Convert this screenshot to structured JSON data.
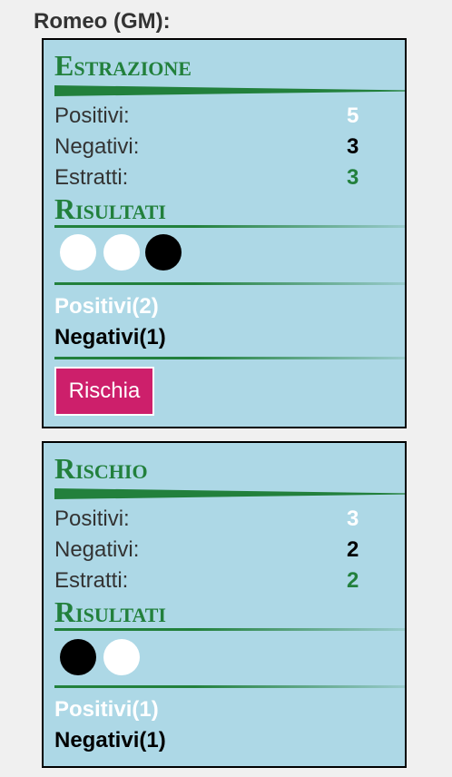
{
  "player_heading": "Romeo (GM):",
  "panels": [
    {
      "title": "Estrazione",
      "rows": [
        {
          "label": "Positivi:",
          "value": "5"
        },
        {
          "label": "Negativi:",
          "value": "3"
        },
        {
          "label": "Estratti:",
          "value": "3"
        }
      ],
      "results_title": "Risultati",
      "balls": [
        "white",
        "white",
        "black"
      ],
      "positivi_summary": "Positivi(2)",
      "negativi_summary": "Negativi(1)",
      "button_label": "Rischia"
    },
    {
      "title": "Rischio",
      "rows": [
        {
          "label": "Positivi:",
          "value": "3"
        },
        {
          "label": "Negativi:",
          "value": "2"
        },
        {
          "label": "Estratti:",
          "value": "2"
        }
      ],
      "results_title": "Risultati",
      "balls": [
        "black",
        "white"
      ],
      "positivi_summary": "Positivi(1)",
      "negativi_summary": "Negativi(1)"
    }
  ],
  "colors": {
    "panel_bg": "#add8e6",
    "title_green": "#22803c",
    "button_bg": "#cd1f6b"
  }
}
